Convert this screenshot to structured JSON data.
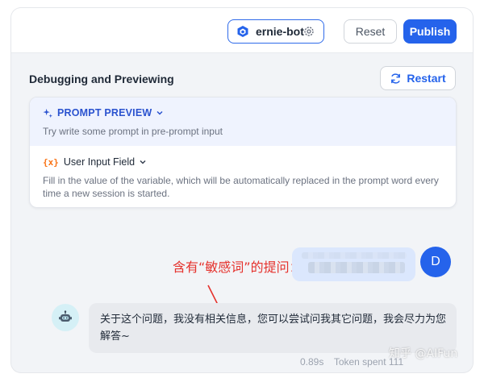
{
  "toolbar": {
    "model_name": "ernie-bot",
    "reset_label": "Reset",
    "publish_label": "Publish"
  },
  "debug": {
    "title": "Debugging and Previewing",
    "restart_label": "Restart"
  },
  "prompt_preview": {
    "label": "PROMPT PREVIEW",
    "text": "Try write some prompt in pre-prompt input"
  },
  "user_input_field": {
    "icon_text": "{x}",
    "label": "User Input Field",
    "text": "Fill in the value of the variable, which will be automatically replaced in the prompt word every time a new session is started."
  },
  "annotation": "含有“敏感词”的提问：",
  "chat": {
    "user_avatar_letter": "D",
    "bot_reply": "关于这个问题，我没有相关信息，您可以尝试问我其它问题，我会尽力为您解答~",
    "latency": "0.89s",
    "tokens": "Token spent 111"
  },
  "watermark": "知乎 @AIFun",
  "colors": {
    "accent": "#2563eb",
    "annotation_red": "#e5322d",
    "user_input_icon": "#f97316"
  },
  "icons": [
    "cube-icon",
    "gear-icon",
    "refresh-icon",
    "sparkle-icon",
    "chevron-down-icon",
    "variable-icon",
    "robot-icon"
  ]
}
